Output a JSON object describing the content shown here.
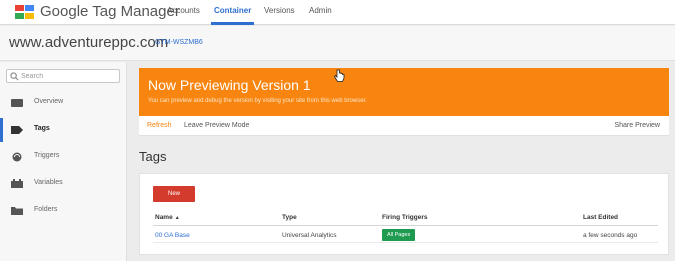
{
  "header": {
    "app_title": "Google Tag Manager",
    "tabs": [
      {
        "label": "Accounts",
        "active": false
      },
      {
        "label": "Container",
        "active": true
      },
      {
        "label": "Versions",
        "active": false
      },
      {
        "label": "Admin",
        "active": false
      }
    ]
  },
  "account": {
    "name": "www.adventureppc.com",
    "container_id": "GTM-WSZMB6"
  },
  "sidebar": {
    "search_placeholder": "Search",
    "items": [
      {
        "label": "Overview",
        "icon": "overview-icon",
        "active": false
      },
      {
        "label": "Tags",
        "icon": "tag-icon",
        "active": true
      },
      {
        "label": "Triggers",
        "icon": "trigger-icon",
        "active": false
      },
      {
        "label": "Variables",
        "icon": "variables-icon",
        "active": false
      },
      {
        "label": "Folders",
        "icon": "folder-icon",
        "active": false
      }
    ]
  },
  "preview": {
    "title": "Now Previewing Version 1",
    "subtitle": "You can preview and debug the version by visiting your site from this web browser.",
    "refresh_label": "Refresh",
    "leave_label": "Leave Preview Mode",
    "share_label": "Share Preview"
  },
  "page": {
    "heading": "Tags",
    "new_button_label": "New"
  },
  "table": {
    "columns": [
      "Name",
      "Type",
      "Firing Triggers",
      "Last Edited"
    ],
    "sort_icon": "▲",
    "rows": [
      {
        "name": "00 GA Base",
        "type": "Universal Analytics",
        "trigger": "All Pages",
        "edited": "a few seconds ago"
      }
    ]
  },
  "colors": {
    "accent": "#2e6fd0",
    "banner": "#f7850f",
    "new_button": "#d33b2c",
    "trigger_chip": "#1e9a51"
  }
}
